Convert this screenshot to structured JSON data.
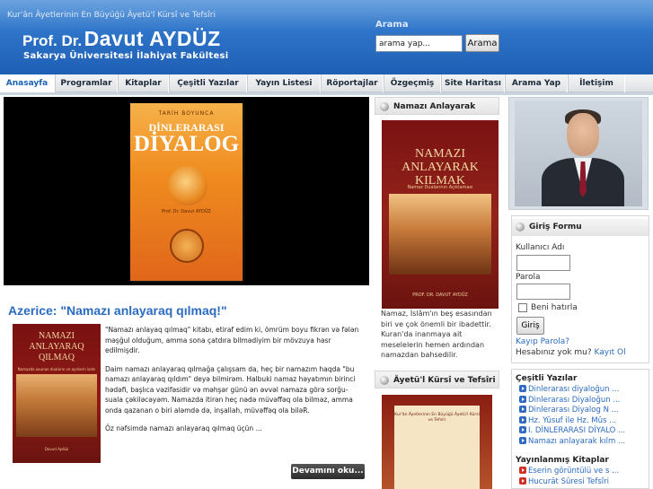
{
  "header": {
    "tagline": "Kur'ân Âyetlerinin En Büyüğü Âyetü'l Kürsî ve Tefsîri",
    "name_prefix": "Prof. Dr.",
    "name": "Davut AYDÜZ",
    "subtitle": "Sakarya Üniversitesi İlahiyat Fakültesi",
    "search_label": "Arama",
    "search_value": "arama yap...",
    "search_button": "Arama"
  },
  "nav": {
    "tabs": [
      {
        "label": "Anasayfa",
        "active": true
      },
      {
        "label": "Programlar"
      },
      {
        "label": "Kitaplar"
      },
      {
        "label": "Çeşitli Yazılar"
      },
      {
        "label": "Yayın Listesi"
      },
      {
        "label": "Röportajlar"
      },
      {
        "label": "Özgeçmiş"
      },
      {
        "label": "Site Haritası"
      },
      {
        "label": "Arama Yap"
      },
      {
        "label": "İletişim"
      }
    ]
  },
  "featured": {
    "book_top": "TARİH BOYUNCA",
    "book_mid": "DİNLERARASI",
    "book_big": "DİYALOG",
    "book_author": "Prof. Dr. Davut AYDÜZ"
  },
  "article": {
    "title": "Azerice: \"Namazı anlayaraq qılmaq!\"",
    "img_title": "NAMAZI ANLAYARAQ QILMAQ",
    "img_sub": "Namazda oxunan duaların və ayələrin izahı",
    "img_author": "Davud Aydüz",
    "paragraphs": [
      "\"Namazı anlayaq qılmaq\" kitabı, etiraf edim ki, ömrüm boyu fikrən və fələn məşğul olduğum, amma sona çatdıra bilmədiyim bir mövzuya həsr edilmişdir.",
      "Daim namazı anlayaraq qılmağa çalışsam da, heç bir namazım haqda \"bu namazı anlayaraq qıldım\" deyə bilmirəm. Halbuki namaz həyatımın birinci hədəfi, başlıca vəzifəsidir və məhşər günü ən əvvəl namaza görə sorğu-suala çəkiləcəyəm. Namazda itirən heç nədə müvəffəq ola bilməz, amma onda qazanan o biri aləmdə də, inşallah, müvəffəq ola biləR.",
      "Öz nəfsimdə namazı anlayaraq qılmaq üçün ..."
    ],
    "more_button": "Devamını oku..."
  },
  "middle": {
    "box1_title": "Namazı Anlayarak Kılmak",
    "book_title": "NAMAZI ANLAYARAK KILMAK",
    "book_sub": "Namaz Dualarının Açıklaması",
    "book_author": "PROF. DR. DAVUT AYDÜZ",
    "text": "Namaz, İslâm'ın beş esasından biri ve çok önemli bir ibadettir. Kuran'da inanmaya ait meselelerin hemen ardından namazdan bahsedilir.",
    "box2_title": "Âyetü'l Kürsî ve Tefsîri",
    "book2_text": "Kur'ân Âyetlerinin En Büyüğü Âyetü'l Kürsî ve Tefsîri"
  },
  "login": {
    "title": "Giriş Formu",
    "username_label": "Kullanıcı Adı",
    "password_label": "Parola",
    "remember_label": "Beni hatırla",
    "button": "Giriş",
    "forgot": "Kayıp Parola?",
    "no_account": "Hesabınız yok mu?",
    "register": "Kayıt Ol"
  },
  "misc": {
    "title1": "Çeşitli Yazılar",
    "items1": [
      "Dinlerarası diyaloğun ...",
      "Dinlerarası Diyaloğun ...",
      "Dinlerarası Diyalog N ...",
      "Hz. Yûsuf ile Hz. Mûs ...",
      "I. DİNLERARASI DİYALO ...",
      "Namazı anlayarak kılm ..."
    ],
    "title2": "Yayınlanmış Kitaplar",
    "items2": [
      "Eserin görüntülü ve s ...",
      "Hucurât Sûresi Tefsîri"
    ]
  }
}
